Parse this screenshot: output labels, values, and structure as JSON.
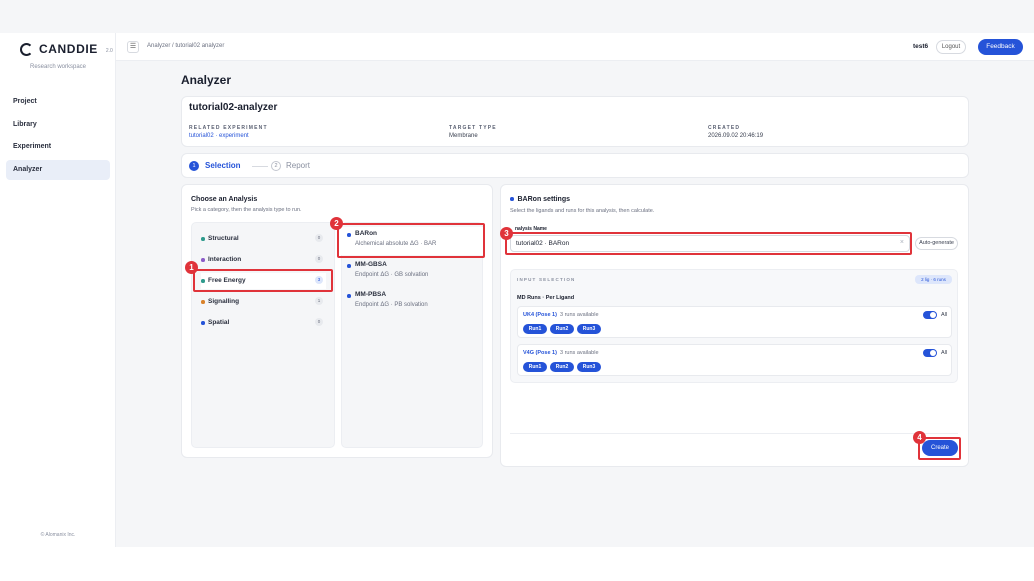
{
  "sidebar": {
    "logo_text": "CANDDIE",
    "logo_version": "2.0",
    "workspace": "Research workspace",
    "items": [
      {
        "label": "Project"
      },
      {
        "label": "Library"
      },
      {
        "label": "Experiment"
      },
      {
        "label": "Analyzer"
      }
    ],
    "copyright": "© Alomanix Inc."
  },
  "topbar": {
    "menu_icon": "☰",
    "breadcrumb": "Analyzer / tutorial02 analyzer",
    "user": "test6",
    "logout": "Logout",
    "feedback": "Feedback",
    "accent_color": "#2553d8"
  },
  "page": {
    "title": "Analyzer"
  },
  "analyzer_card": {
    "name": "tutorial02-analyzer",
    "related_label": "RELATED EXPERIMENT",
    "related_value": "tutorial02 · experiment",
    "target_label": "TARGET TYPE",
    "target_value": "Membrane",
    "created_label": "CREATED",
    "created_value": "2026.09.02 20:46:19"
  },
  "steps": [
    {
      "num": "1",
      "label": "Selection"
    },
    {
      "num": "2",
      "label": "Report"
    }
  ],
  "choose": {
    "title": "Choose an Analysis",
    "subtitle": "Pick a category, then the analysis type to run.",
    "categories": [
      {
        "label": "Structural",
        "count": "0"
      },
      {
        "label": "Interaction",
        "count": "0"
      },
      {
        "label": "Free Energy",
        "count": "3"
      },
      {
        "label": "Signalling",
        "count": "1"
      },
      {
        "label": "Spatial",
        "count": "0"
      }
    ],
    "types": [
      {
        "name": "BARon",
        "desc": "Alchemical absolute ΔG · BAR"
      },
      {
        "name": "MM-GBSA",
        "desc": "Endpoint ΔG · GB solvation"
      },
      {
        "name": "MM-PBSA",
        "desc": "Endpoint ΔG · PB solvation"
      }
    ]
  },
  "settings": {
    "title": "BARon settings",
    "subtitle": "Select the ligands and runs for this analysis, then calculate.",
    "name_label": "nalysis Name",
    "name_value": "tutorial02 · BARon",
    "clear_icon": "×",
    "auto_generate": "Auto-generate",
    "input_selection_label": "INPUT SELECTION",
    "selection_badge": "2 lig · 6 runs",
    "md_runs_label": "MD Runs · Per Ligand",
    "ligands": [
      {
        "name": "UK4 (Pose 1)",
        "avail": "3 runs available",
        "all": "All",
        "runs": [
          "Run1",
          "Run2",
          "Run3"
        ]
      },
      {
        "name": "V4G (Pose 1)",
        "avail": "3 runs available",
        "all": "All",
        "runs": [
          "Run1",
          "Run2",
          "Run3"
        ]
      }
    ],
    "create": "Create"
  },
  "annotations": [
    "1",
    "2",
    "3",
    "4"
  ]
}
